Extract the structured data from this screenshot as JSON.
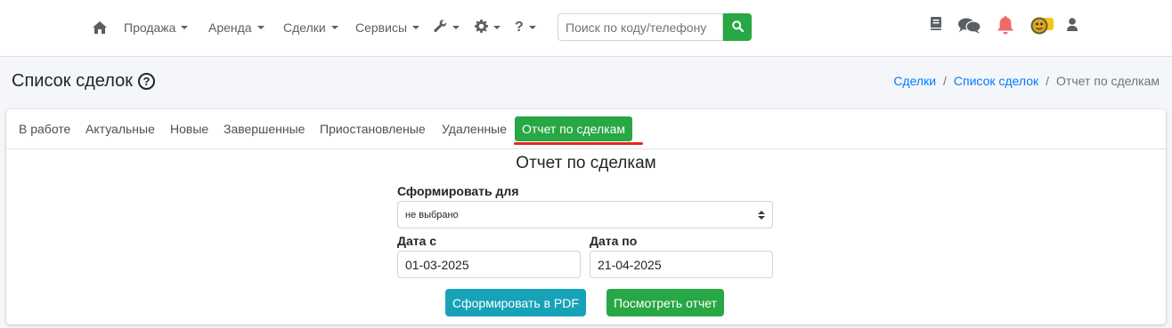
{
  "navbar": {
    "menu": [
      {
        "label": "Продажа"
      },
      {
        "label": "Аренда"
      },
      {
        "label": "Сделки"
      },
      {
        "label": "Сервисы"
      }
    ],
    "icons": [
      "home-icon",
      "wrench-icon",
      "gear-icon",
      "question-icon"
    ],
    "help_symbol": "?",
    "search": {
      "placeholder": "Поиск по коду/телефону"
    },
    "right_icons": [
      "book-icon",
      "comments-icon",
      "bell-icon",
      "avatar",
      "user-icon"
    ]
  },
  "page": {
    "title": "Список сделок",
    "breadcrumb": [
      {
        "label": "Сделки",
        "link": true
      },
      {
        "label": "Список сделок",
        "link": true
      },
      {
        "label": "Отчет по сделкам",
        "link": false
      }
    ]
  },
  "tabs": [
    {
      "label": "В работе",
      "active": false
    },
    {
      "label": "Актуальные",
      "active": false
    },
    {
      "label": "Новые",
      "active": false
    },
    {
      "label": "Завершенные",
      "active": false
    },
    {
      "label": "Приостановленые",
      "active": false
    },
    {
      "label": "Удаленные",
      "active": false
    },
    {
      "label": "Отчет по сделкам",
      "active": true
    }
  ],
  "report": {
    "title": "Отчет по сделкам",
    "for_label": "Сформировать для",
    "for_value": "не выбрано",
    "date_from_label": "Дата с",
    "date_from_value": "01-03-2025",
    "date_to_label": "Дата по",
    "date_to_value": "21-04-2025",
    "pdf_button": "Сформировать в PDF",
    "view_button": "Посмотреть отчет"
  },
  "colors": {
    "accent_green": "#28a745",
    "info_teal": "#17a2b8",
    "link_blue": "#007bff",
    "underline_red": "#e8261a",
    "bell_red": "#f06a6a"
  }
}
